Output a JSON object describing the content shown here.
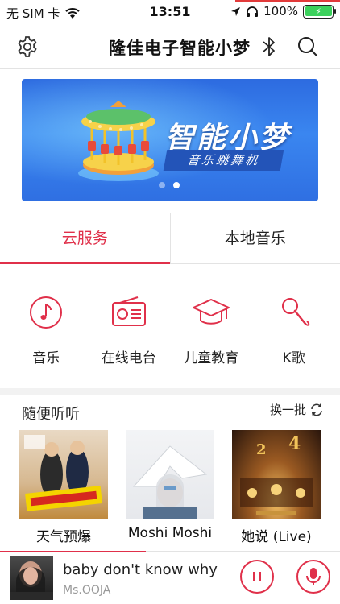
{
  "status_bar": {
    "carrier": "无 SIM 卡",
    "time": "13:51",
    "battery": "100%"
  },
  "header": {
    "title": "隆佳电子智能小梦"
  },
  "banner": {
    "brand": "智能小梦",
    "subtitle": "音乐跳舞机",
    "active_slide": 2,
    "slide_count": 2
  },
  "tabs": [
    {
      "label": "云服务",
      "active": true
    },
    {
      "label": "本地音乐",
      "active": false
    }
  ],
  "categories": [
    {
      "label": "音乐",
      "icon": "music-note-icon"
    },
    {
      "label": "在线电台",
      "icon": "radio-icon"
    },
    {
      "label": "儿童教育",
      "icon": "graduation-cap-icon"
    },
    {
      "label": "K歌",
      "icon": "microphone-icon"
    }
  ],
  "recommend": {
    "title": "随便听听",
    "refresh_label": "换一批",
    "albums": [
      {
        "name": "天气预爆"
      },
      {
        "name": "Moshi Moshi"
      },
      {
        "name": "她说 (Live)"
      }
    ]
  },
  "player": {
    "song": "baby don't know why",
    "artist": "Ms.OOJA",
    "progress": 0.43
  },
  "colors": {
    "accent": "#e0304a",
    "banner": "#3a86f0"
  }
}
